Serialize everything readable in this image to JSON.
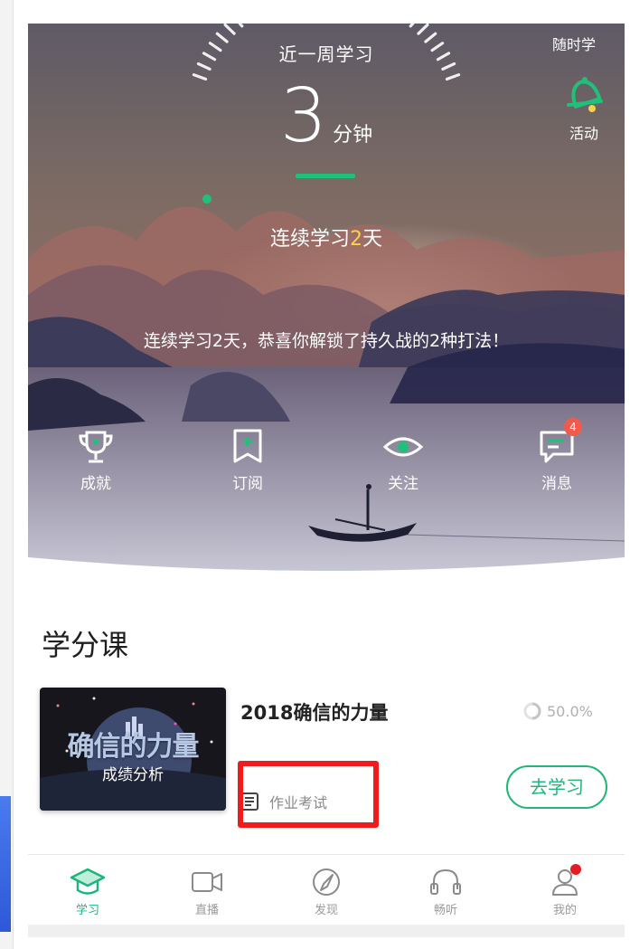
{
  "hero": {
    "week_label": "近一周学习",
    "minutes_value": "3",
    "minutes_unit": "分钟",
    "streak_prefix": "连续学习",
    "streak_days": "2",
    "streak_suffix": "天",
    "anytime_label": "随时学",
    "activity_label": "活动",
    "unlock_message": "连续学习2天，恭喜你解锁了持久战的2种打法！",
    "quick_actions": [
      {
        "label": "成就",
        "icon": "trophy-icon"
      },
      {
        "label": "订阅",
        "icon": "bookmark-icon"
      },
      {
        "label": "关注",
        "icon": "eye-icon"
      },
      {
        "label": "消息",
        "icon": "message-icon",
        "badge": "4"
      }
    ]
  },
  "section": {
    "title": "学分课"
  },
  "course": {
    "thumb_title": "确信的力量",
    "thumb_subtitle": "成绩分析",
    "title": "2018确信的力量",
    "progress": "50.0%",
    "homework_label": "作业考试",
    "go_study_label": "去学习"
  },
  "bottom_nav": [
    {
      "label": "学习",
      "icon": "graduation-cap-icon",
      "active": true
    },
    {
      "label": "直播",
      "icon": "video-camera-icon",
      "active": false
    },
    {
      "label": "发现",
      "icon": "compass-icon",
      "active": false
    },
    {
      "label": "畅听",
      "icon": "headphones-icon",
      "active": false
    },
    {
      "label": "我的",
      "icon": "profile-icon",
      "active": false
    }
  ],
  "colors": {
    "accent_green": "#1fb57a",
    "highlight_red": "#ee1c1c",
    "badge_red": "#f25b4c",
    "streak_yellow": "#f6d34a"
  }
}
